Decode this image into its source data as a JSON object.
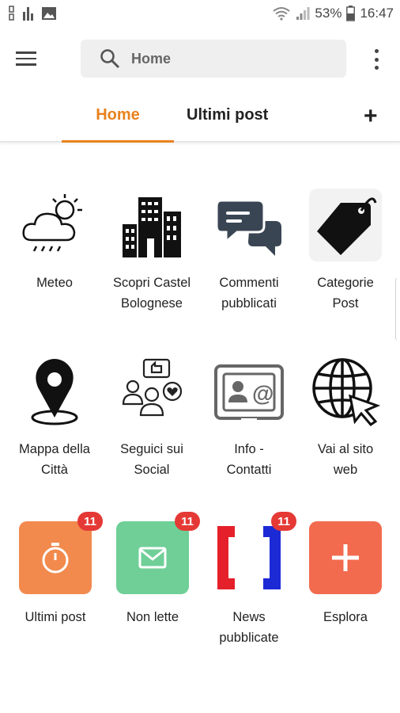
{
  "status_bar": {
    "battery": "53%",
    "time": "16:47"
  },
  "search": {
    "placeholder": "Home"
  },
  "tabs": [
    {
      "label": "Home"
    },
    {
      "label": "Ultimi post"
    }
  ],
  "grid": {
    "meteo": "Meteo",
    "scopri_1": "Scopri Castel",
    "scopri_2": "Bolognese",
    "commenti_1": "Commenti",
    "commenti_2": "pubblicati",
    "categorie_1": "Categorie",
    "categorie_2": "Post",
    "mappa_1": "Mappa della",
    "mappa_2": "Città",
    "seguici_1": "Seguici sui",
    "seguici_2": "Social",
    "info_1": "Info -",
    "info_2": "Contatti",
    "vai_1": "Vai al sito",
    "vai_2": "web"
  },
  "tiles": {
    "ultimi_post": {
      "label": "Ultimi post",
      "badge": "11",
      "color": "#f28a4e"
    },
    "non_lette": {
      "label": "Non lette",
      "badge": "11",
      "color": "#6fcf97"
    },
    "news_1": "News",
    "news_2": "pubblicate",
    "news_badge": "11",
    "esplora": {
      "label": "Esplora",
      "color": "#f26b4f"
    }
  },
  "colors": {
    "accent": "#e8821e",
    "badge": "#e53935"
  },
  "icons": [
    "wifi-icon",
    "signal-icon",
    "battery-icon",
    "search-icon",
    "menu-icon",
    "more-vert-icon",
    "plus-icon",
    "weather-icon",
    "city-buildings-icon",
    "chat-bubbles-icon",
    "tag-icon",
    "map-pin-icon",
    "social-people-icon",
    "contact-card-icon",
    "globe-cursor-icon",
    "stopwatch-icon",
    "envelope-icon",
    "brackets-icon"
  ]
}
